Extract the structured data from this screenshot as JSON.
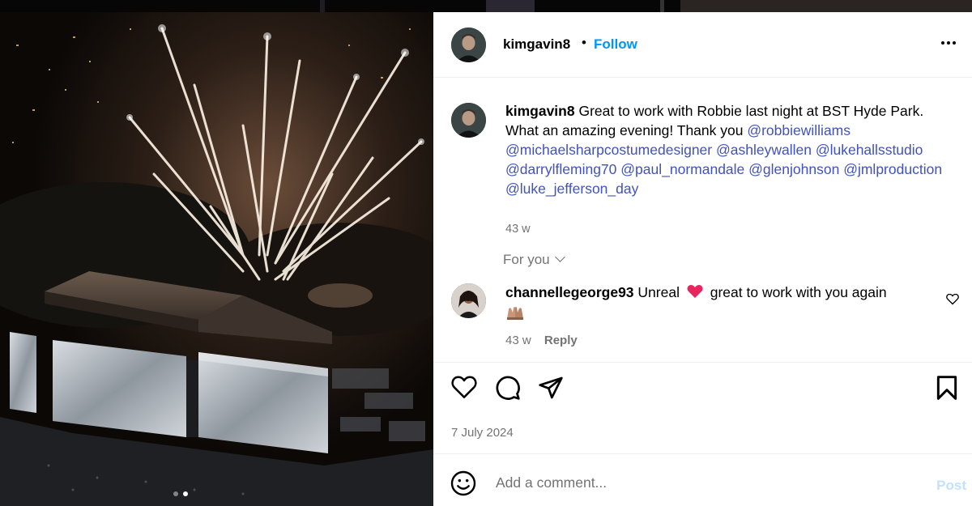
{
  "post": {
    "username": "kimgavin8",
    "follow_label": "Follow",
    "separator": "•",
    "caption_user": "kimgavin8",
    "caption_text": "Great to work with Robbie last night at BST Hyde Park. What an amazing evening! Thank you",
    "mentions": [
      "@robbiewilliams",
      "@michaelsharpcostumedesigner",
      "@ashleywallen",
      "@lukehallsstudio",
      "@darrylfleming70",
      "@paul_normandale",
      "@glenjohnson",
      "@jmlproduction",
      "@luke_jefferson_day"
    ],
    "caption_time": "43 w",
    "date": "7 July 2024",
    "carousel": {
      "total": 2,
      "current": 2
    }
  },
  "for_you_label": "For you",
  "comment": {
    "username": "channellegeorge93",
    "text_before": "Unreal",
    "text_after": "great to work with you again",
    "second_line_icon": "raising-hands-emoji",
    "time": "43 w",
    "reply_label": "Reply"
  },
  "composer": {
    "placeholder": "Add a comment...",
    "post_label": "Post"
  },
  "icons": {
    "more": "more-horizontal-icon",
    "like": "heart-icon",
    "comment": "comment-icon",
    "share": "send-icon",
    "save": "bookmark-icon",
    "emoji": "smiley-icon"
  },
  "colors": {
    "accent": "#0095f6",
    "mention": "#4153b6",
    "muted": "#737373",
    "post_disabled": "#c3e1fc",
    "heart_emoji": "#e8265e"
  }
}
